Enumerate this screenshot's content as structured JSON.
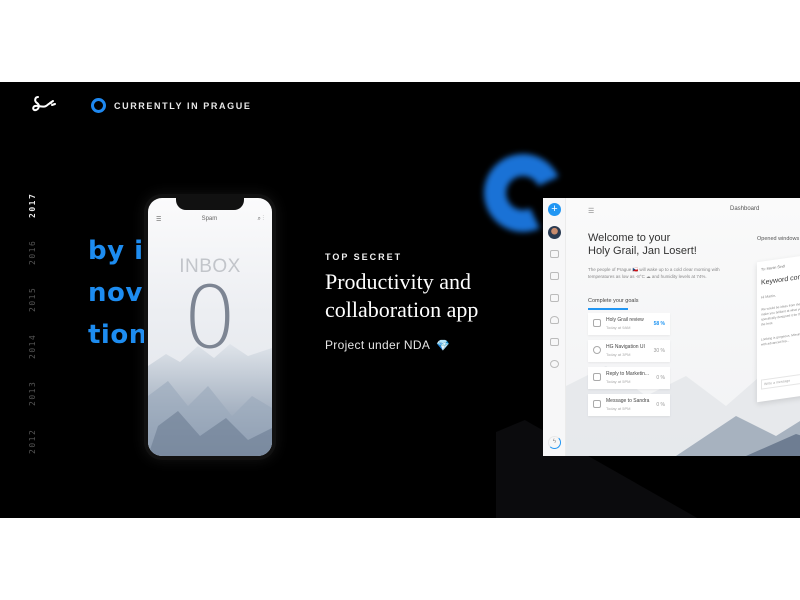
{
  "header": {
    "location_label": "CURRENTLY IN PRAGUE",
    "accent_color": "#1e88f0",
    "socials": [
      {
        "name": "twitter-icon"
      },
      {
        "name": "instagram-icon"
      },
      {
        "name": "dribbble-icon"
      }
    ]
  },
  "timeline": {
    "years": [
      "2017",
      "2016",
      "2015",
      "2014",
      "2013",
      "2012"
    ],
    "active": "2017"
  },
  "headline": {
    "lines": [
      "by ir",
      "novo",
      "tion."
    ]
  },
  "phone": {
    "title": "Spam",
    "inbox_label": "INBOX",
    "inbox_count": "0"
  },
  "project": {
    "kicker": "TOP SECRET",
    "title_line1": "Productivity and",
    "title_line2": "collaboration app",
    "subtitle": "Project under NDA",
    "subtitle_icon": "💎"
  },
  "dashboard": {
    "title": "Dashboard",
    "welcome_line1": "Welcome to your",
    "welcome_line2": "Holy Grail, Jan Losert!",
    "weather_text": "The people of Prague 🇨🇿 will wake up to a cold clear morning with temperatures as low as -8°C ☁ and humidity levels at 74%.",
    "goals_heading": "Complete your goals",
    "goals": [
      {
        "title": "Holy Grail review",
        "time": "Today at 9AM",
        "progress": "58 %",
        "highlight": true
      },
      {
        "title": "HG Navigation UI",
        "time": "Today at 3PM",
        "progress": "30 %",
        "highlight": false
      },
      {
        "title": "Reply to Marketin...",
        "time": "Today at 5PM",
        "progress": "0 %",
        "highlight": false
      },
      {
        "title": "Message to Sandra",
        "time": "Today at 5PM",
        "progress": "0 %",
        "highlight": false
      }
    ],
    "opened_windows_label": "Opened windows",
    "window": {
      "to": "To: Martin Šindl",
      "heading": "Keyword competiti...",
      "greeting": "Hi Martin,",
      "para1": "We would be ideas from the given one make you brilliant at what you do, specifically designed it for those want the best.",
      "para2": "Looking is gorgeous. Missingly comes with advanced fea...",
      "input_placeholder": "Write a message"
    }
  }
}
